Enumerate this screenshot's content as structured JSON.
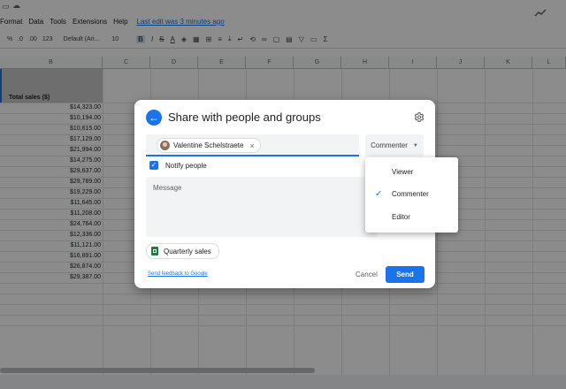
{
  "menubar": {
    "items": [
      "Format",
      "Data",
      "Tools",
      "Extensions",
      "Help"
    ],
    "last_edit": "Last edit was 3 minutes ago"
  },
  "toolbar": {
    "percent": "%",
    "dec_decrease": ".0",
    "dec_increase": ".00",
    "number_format": "123",
    "font": "Default (Ari...",
    "font_size": "10"
  },
  "sheet": {
    "columns": [
      "B",
      "C",
      "D",
      "E",
      "F",
      "G",
      "H",
      "I",
      "J",
      "K",
      "L"
    ],
    "header_cell": "Total sales ($)",
    "values": [
      "$14,323.00",
      "$10,194.00",
      "$10,615.00",
      "$17,129.00",
      "$21,994.00",
      "$14,275.00",
      "$29,637.00",
      "$29,789.00",
      "$19,229.00",
      "$11,645.00",
      "$11,208.00",
      "$24,764.00",
      "$12,336.00",
      "$11,121.00",
      "$16,891.00",
      "$26,874.00",
      "$29,387.00"
    ]
  },
  "dialog": {
    "title": "Share with people and groups",
    "chip_name": "Valentine Schelstraete",
    "chip_remove": "×",
    "role": "Commenter",
    "notify_label": "Notify people",
    "message_placeholder": "Message",
    "attachment": "Quarterly sales",
    "feedback_link": "Send feedback to Google",
    "cancel": "Cancel",
    "send": "Send"
  },
  "role_menu": {
    "options": [
      "Viewer",
      "Commenter",
      "Editor"
    ],
    "selected": "Commenter"
  },
  "colors": {
    "accent": "#1a73e8",
    "overlay": "rgba(0,0,0,0.45)"
  }
}
